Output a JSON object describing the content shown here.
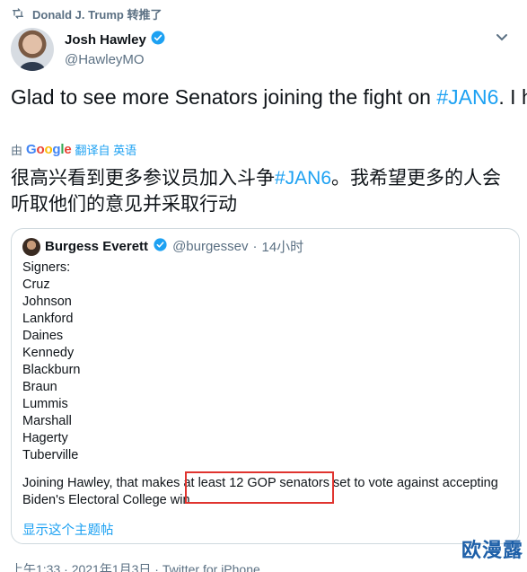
{
  "retweet": {
    "label": "Donald J. Trump 转推了"
  },
  "author": {
    "name": "Josh Hawley",
    "handle": "@HawleyMO"
  },
  "tweet": {
    "text_part1": "Glad to see more Senators joining the fight on ",
    "hashtag": "#JAN6",
    "text_part2": ". I hope many more will listen to their constituents and act"
  },
  "translation": {
    "prefix": "由",
    "google": [
      "G",
      "o",
      "o",
      "g",
      "l",
      "e"
    ],
    "link": "翻译自 英语",
    "text_part1": "很高兴看到更多参议员加入斗争",
    "hashtag": "#JAN6",
    "text_part2": "。我希望更多的人会听取他们的意见并采取行动"
  },
  "quote": {
    "name": "Burgess Everett",
    "handle": "@burgessev",
    "dot": "·",
    "time": "14小时",
    "signers_label": "Signers:",
    "signers": [
      "Cruz",
      "Johnson",
      "Lankford",
      "Daines",
      "Kennedy",
      "Blackburn",
      "Braun",
      "Lummis",
      "Marshall",
      "Hagerty",
      "Tuberville"
    ],
    "closing": "Joining Hawley, that makes at least 12 GOP senators set to vote against accepting Biden's Electoral College win",
    "show_thread": "显示这个主题帖"
  },
  "footer": {
    "meta": "上午1:33 · 2021年1月3日 · Twitter for iPhone"
  },
  "watermark": "欧漫露",
  "colors": {
    "accent": "#1da1f2",
    "muted": "#5b7083",
    "highlight": "#e0342f"
  }
}
